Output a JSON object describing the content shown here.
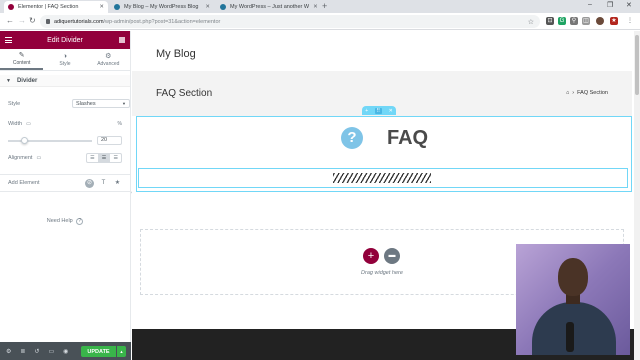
{
  "browser": {
    "tabs": [
      {
        "title": "Elementor | FAQ Section",
        "active": true
      },
      {
        "title": "My Blog – My WordPress Blog",
        "active": false
      },
      {
        "title": "My WordPress – Just another W",
        "active": false
      }
    ],
    "new_tab": "+",
    "window_controls": [
      "–",
      "❐",
      "✕"
    ],
    "url_host": "adiquertutorials.com",
    "url_path": "/wp-admin/post.php?post=31&action=elementor"
  },
  "panel": {
    "title": "Edit Divider",
    "tabs": [
      {
        "label": "Content",
        "icon": "✎"
      },
      {
        "label": "Style",
        "icon": "◑"
      },
      {
        "label": "Advanced",
        "icon": "⚙"
      }
    ],
    "section_title": "Divider",
    "style_label": "Style",
    "style_value": "Slashes",
    "width_label": "Width",
    "width_unit": "%",
    "width_value": "20",
    "alignment_label": "Alignment",
    "add_element_label": "Add Element",
    "need_help": "Need Help",
    "update_label": "UPDATE"
  },
  "preview": {
    "site_title": "My Blog",
    "page_title": "FAQ Section",
    "breadcrumb_current": "FAQ Section",
    "faq_icon_text": "?",
    "faq_heading": "FAQ",
    "drag_widget_text": "Drag widget here",
    "section_handle_add": "+",
    "section_handle_mid": "⠿",
    "section_handle_close": "✕"
  },
  "colors": {
    "elementor_brand": "#92003b",
    "update_green": "#39b54a",
    "selection_blue": "#71d7f7",
    "faq_icon": "#7fc4e7"
  }
}
